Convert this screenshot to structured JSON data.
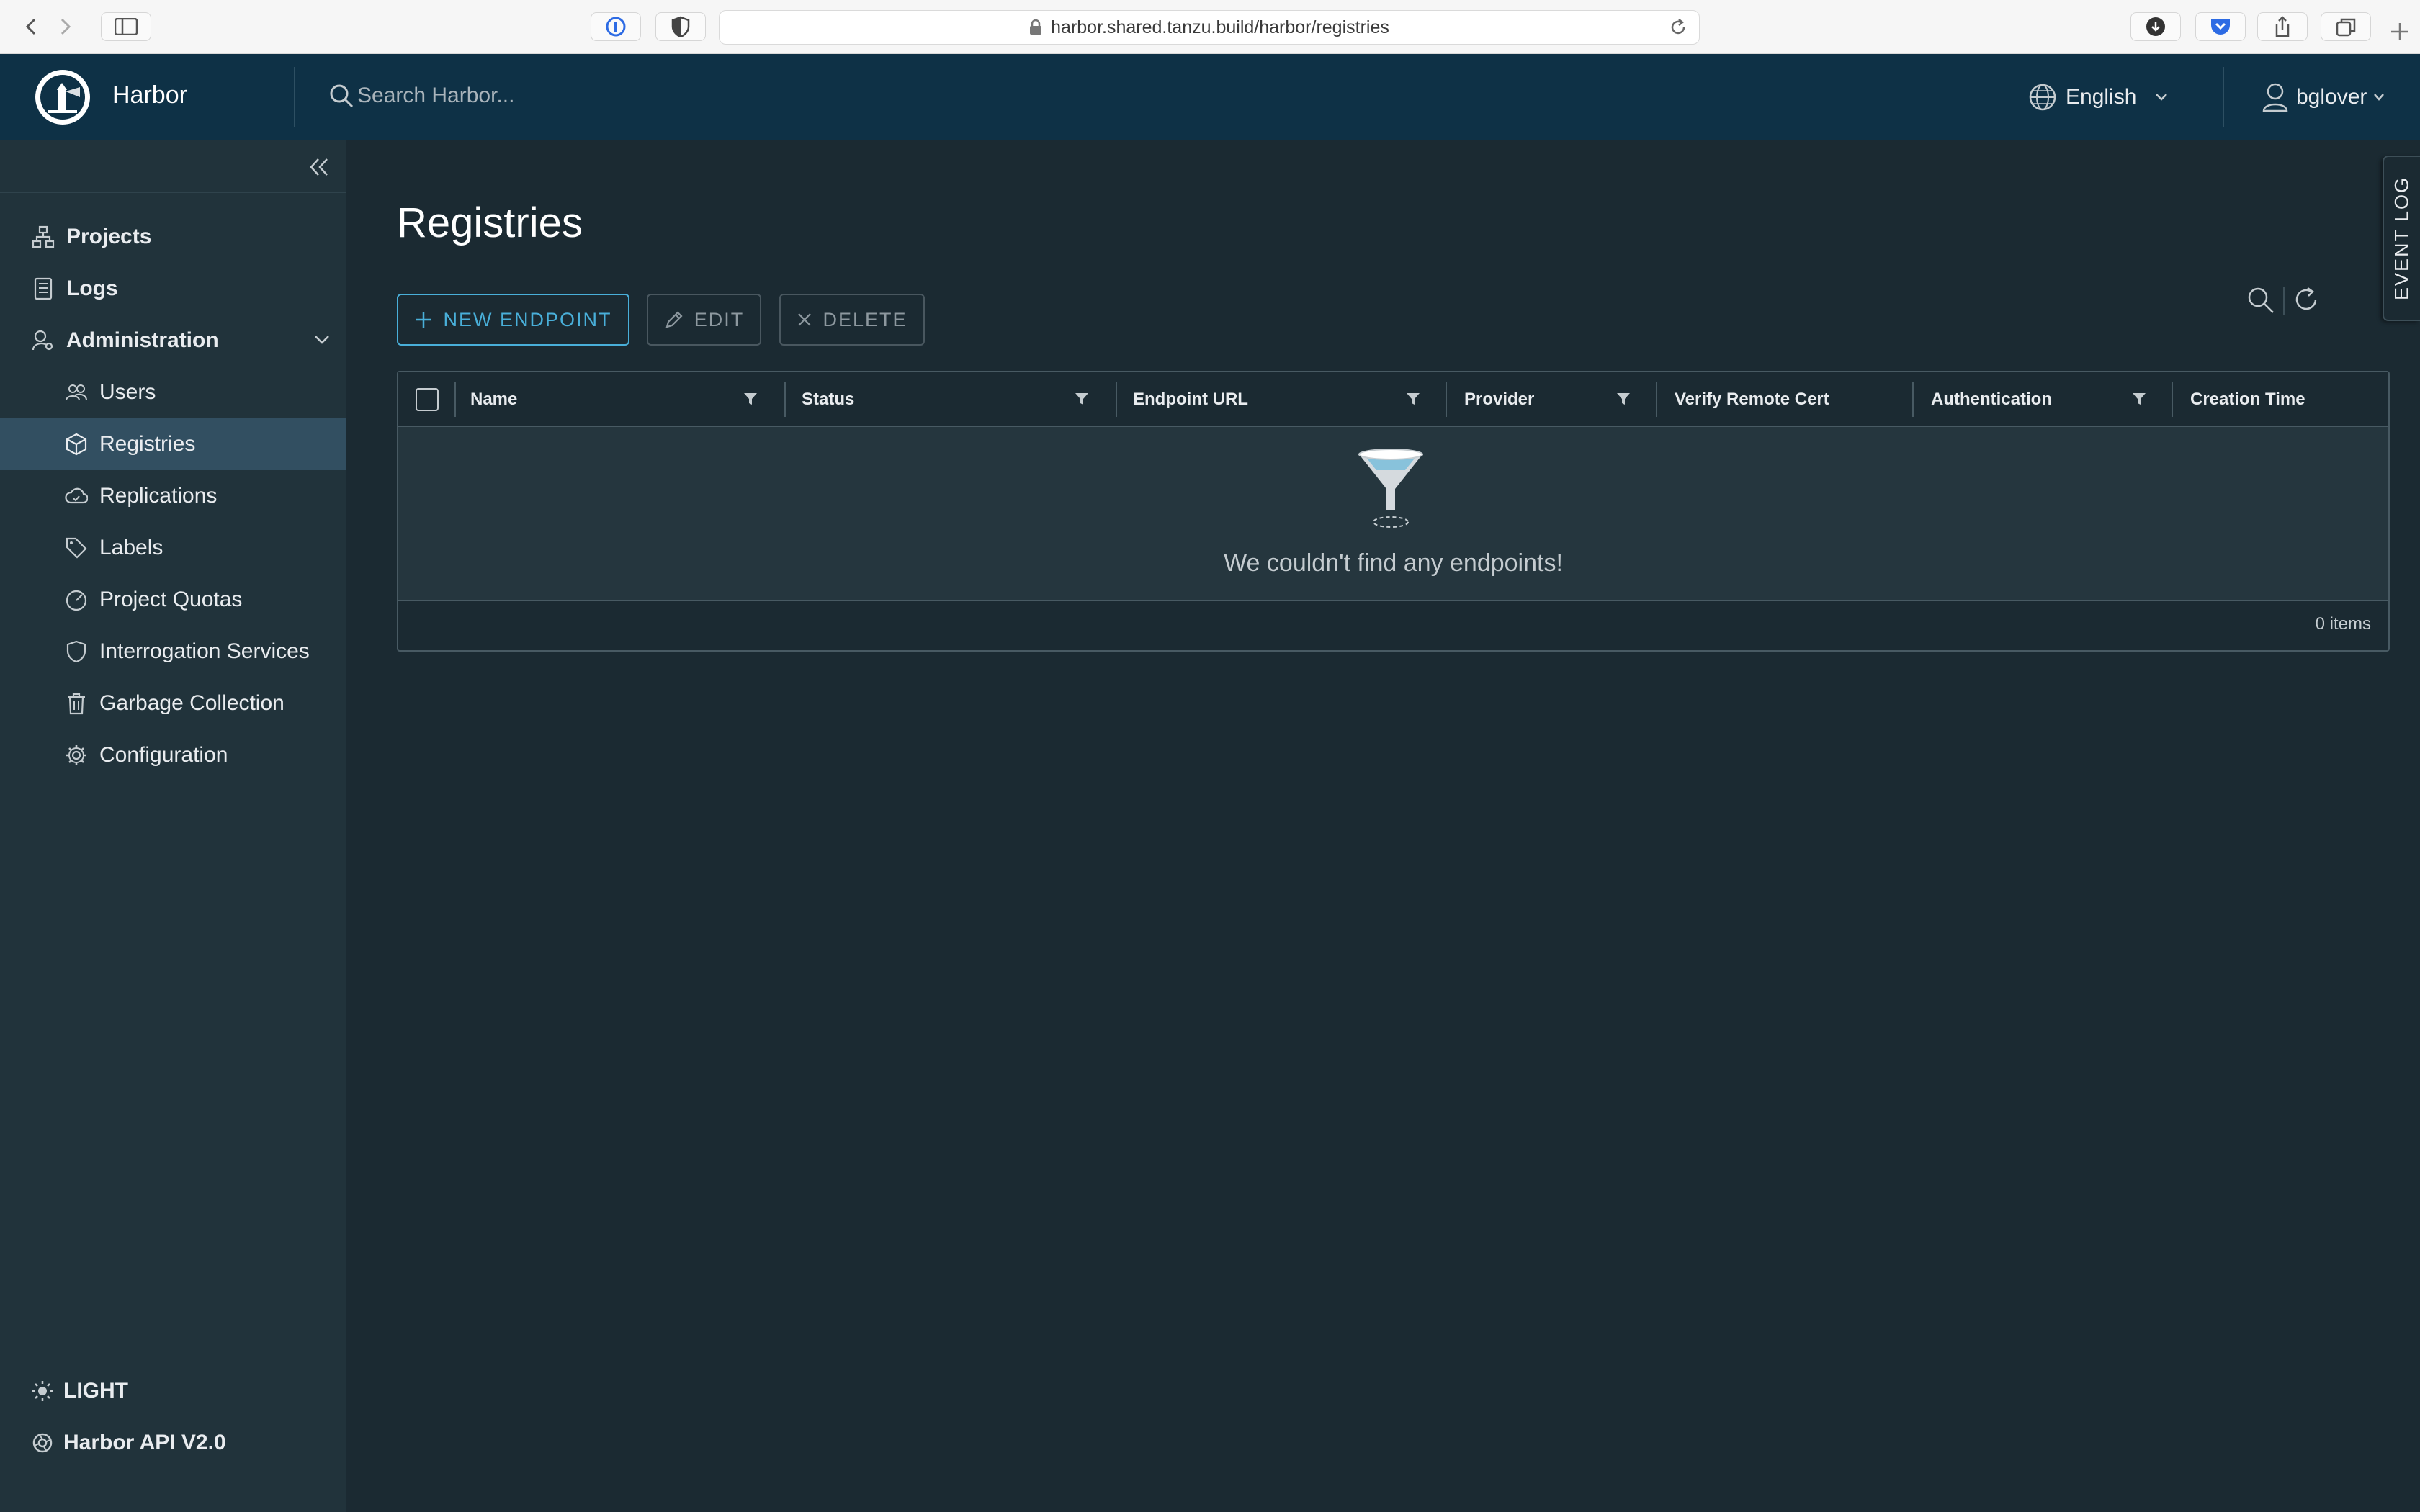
{
  "browser": {
    "url": "harbor.shared.tanzu.build/harbor/registries"
  },
  "header": {
    "app_title": "Harbor",
    "search_placeholder": "Search Harbor...",
    "language": "English",
    "username": "bglover"
  },
  "sidebar": {
    "items": [
      {
        "label": "Projects",
        "icon": "projects-icon"
      },
      {
        "label": "Logs",
        "icon": "logs-icon"
      },
      {
        "label": "Administration",
        "icon": "admin-icon"
      }
    ],
    "admin_items": [
      {
        "label": "Users",
        "icon": "users-icon"
      },
      {
        "label": "Registries",
        "icon": "registries-icon",
        "active": true
      },
      {
        "label": "Replications",
        "icon": "replications-icon"
      },
      {
        "label": "Labels",
        "icon": "labels-icon"
      },
      {
        "label": "Project Quotas",
        "icon": "quotas-icon"
      },
      {
        "label": "Interrogation Services",
        "icon": "shield-icon"
      },
      {
        "label": "Garbage Collection",
        "icon": "trash-icon"
      },
      {
        "label": "Configuration",
        "icon": "gear-icon"
      }
    ],
    "footer": {
      "theme_label": "LIGHT",
      "api_label": "Harbor API V2.0"
    }
  },
  "main": {
    "title": "Registries",
    "buttons": {
      "new_endpoint": "NEW ENDPOINT",
      "edit": "EDIT",
      "delete": "DELETE"
    },
    "event_log": "EVENT LOG",
    "table": {
      "columns": [
        "Name",
        "Status",
        "Endpoint URL",
        "Provider",
        "Verify Remote Cert",
        "Authentication",
        "Creation Time"
      ],
      "empty_message": "We couldn't find any endpoints!",
      "items_count": "0 items"
    }
  },
  "colors": {
    "accent": "#49afd9",
    "header_bg": "#0e3146",
    "sidebar_bg": "#21333b",
    "content_bg": "#1b2a32",
    "active_item_bg": "#324f61"
  }
}
